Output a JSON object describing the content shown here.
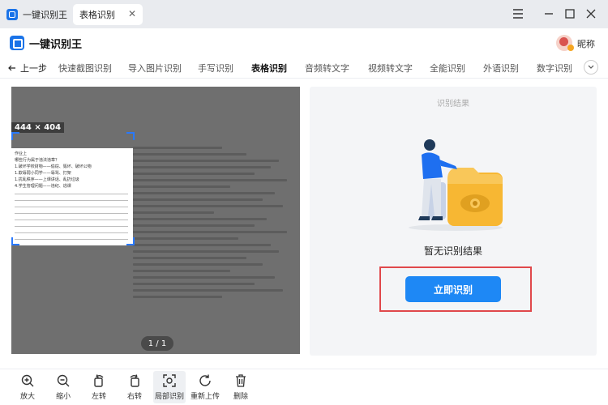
{
  "titlebar": {
    "app_tab_label": "一键识别王",
    "doc_tab_label": "表格识别",
    "close_glyph": "✕"
  },
  "header": {
    "brand_name": "一键识别王",
    "nickname": "昵称"
  },
  "nav": {
    "back_label": "上一步",
    "items": [
      "快速截图识别",
      "导入图片识别",
      "手写识别",
      "表格识别",
      "音频转文字",
      "视频转文字",
      "全能识别",
      "外语识别",
      "数字识别"
    ],
    "active_index": 3
  },
  "preview": {
    "size_label": "444 × 404",
    "page_indicator": "1 / 1",
    "doc_lines": [
      "作业上",
      "哪些行为属于违法违章？",
      "1.破坏学校财物——偷窃、毁坏、破坏公物",
      "1.欺辱弱小同学——辱骂、打架",
      "1.扰乱秩序——上课讲话、乱扔垃圾",
      "4.学生管理问题——违纪、逃课"
    ]
  },
  "result": {
    "title": "识别结果",
    "empty_text": "暂无识别结果",
    "recognize_button": "立即识别"
  },
  "toolbar": {
    "items": [
      {
        "label": "放大",
        "icon": "zoom-in-icon"
      },
      {
        "label": "缩小",
        "icon": "zoom-out-icon"
      },
      {
        "label": "左转",
        "icon": "rotate-left-icon"
      },
      {
        "label": "右转",
        "icon": "rotate-right-icon"
      },
      {
        "label": "局部识别",
        "icon": "partial-recognize-icon"
      },
      {
        "label": "重新上传",
        "icon": "reupload-icon"
      },
      {
        "label": "删除",
        "icon": "trash-icon"
      }
    ],
    "active_index": 4
  },
  "colors": {
    "accent": "#1e88f5",
    "highlight": "#e0484b",
    "selection": "#2979ff"
  }
}
